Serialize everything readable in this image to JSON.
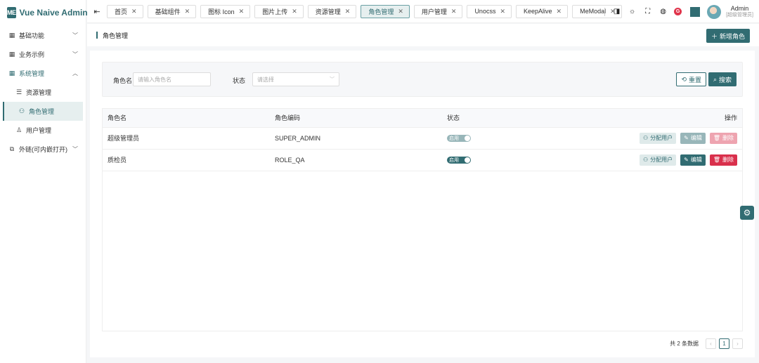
{
  "app": {
    "logo_mark": "ME",
    "title": "Vue Naive Admin"
  },
  "sidebar": {
    "items": [
      {
        "label": "基础功能",
        "icon": "grid-icon",
        "chevron": "⌄"
      },
      {
        "label": "业务示例",
        "icon": "grid-icon",
        "chevron": "⌄"
      },
      {
        "label": "系统管理",
        "icon": "grid-icon",
        "chevron": "⌃"
      },
      {
        "label": "资源管理",
        "icon": "list-icon"
      },
      {
        "label": "角色管理",
        "icon": "user-check-icon"
      },
      {
        "label": "用户管理",
        "icon": "user-icon"
      },
      {
        "label": "外链(可内嵌打开)",
        "icon": "external-link-icon",
        "chevron": "⌄"
      }
    ]
  },
  "header": {
    "tabs": [
      {
        "label": "首页"
      },
      {
        "label": "基础组件"
      },
      {
        "label": "图标 Icon"
      },
      {
        "label": "图片上传"
      },
      {
        "label": "资源管理"
      },
      {
        "label": "角色管理",
        "active": true
      },
      {
        "label": "用户管理"
      },
      {
        "label": "Unocss"
      },
      {
        "label": "KeepAlive"
      },
      {
        "label": "MeModal"
      }
    ],
    "theme_color": "#316c72",
    "user": {
      "name": "Admin",
      "role": "[超级管理员]"
    }
  },
  "page": {
    "title": "角色管理",
    "add_button": "新增角色",
    "search": {
      "role_name_label": "角色名",
      "role_name_placeholder": "请输入角色名",
      "status_label": "状态",
      "status_placeholder": "请选择",
      "reset_label": "重置",
      "search_label": "搜索"
    },
    "table": {
      "headers": [
        "角色名",
        "角色编码",
        "状态",
        "操作"
      ],
      "rows": [
        {
          "name": "超级管理员",
          "code": "SUPER_ADMIN",
          "status": "启用"
        },
        {
          "name": "质检员",
          "code": "ROLE_QA",
          "status": "启用"
        }
      ],
      "actions": {
        "assign": "分配用户",
        "edit": "编辑",
        "delete": "删除"
      }
    },
    "pagination": {
      "total_text": "共 2 条数据",
      "current_page": "1",
      "prev": "‹",
      "next": "›"
    }
  }
}
